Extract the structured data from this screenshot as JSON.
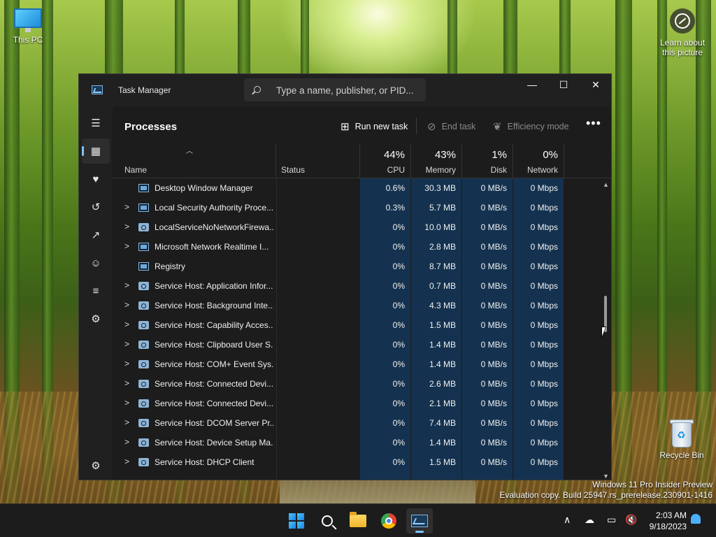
{
  "desktop": {
    "this_pc_label": "This PC",
    "recycle_bin_label": "Recycle Bin",
    "learn_line1": "Learn about",
    "learn_line2": "this picture",
    "watermark_line1": "Windows 11 Pro Insider Preview",
    "watermark_line2": "Evaluation copy. Build 25947.rs_prerelease.230901-1416"
  },
  "window": {
    "title": "Task Manager",
    "search_placeholder": "Type a name, publisher, or PID...",
    "minimize_glyph": "—",
    "maximize_glyph": "☐",
    "close_glyph": "✕"
  },
  "nav": {
    "items": [
      {
        "icon": "hamburger-icon",
        "glyph": "☰"
      },
      {
        "icon": "processes-icon",
        "glyph": "▦"
      },
      {
        "icon": "performance-icon",
        "glyph": "♥"
      },
      {
        "icon": "app-history-icon",
        "glyph": "↺"
      },
      {
        "icon": "startup-apps-icon",
        "glyph": "↗"
      },
      {
        "icon": "users-icon",
        "glyph": "☺"
      },
      {
        "icon": "details-icon",
        "glyph": "≡"
      },
      {
        "icon": "services-icon",
        "glyph": "⚙"
      }
    ],
    "settings_glyph": "⚙"
  },
  "toolbar": {
    "page_title": "Processes",
    "run_new_task": "Run new task",
    "end_task": "End task",
    "efficiency_mode": "Efficiency mode",
    "more_glyph": "•••"
  },
  "columns": {
    "name": "Name",
    "status": "Status",
    "cpu_pct": "44%",
    "cpu": "CPU",
    "memory_pct": "43%",
    "memory": "Memory",
    "disk_pct": "1%",
    "disk": "Disk",
    "network_pct": "0%",
    "network": "Network"
  },
  "processes": [
    {
      "name": "Desktop Window Manager",
      "expandable": false,
      "icon": "box",
      "cpu": "0.6%",
      "memory": "30.3 MB",
      "disk": "0 MB/s",
      "network": "0 Mbps"
    },
    {
      "name": "Local Security Authority Proce...",
      "expandable": true,
      "icon": "box",
      "cpu": "0.3%",
      "memory": "5.7 MB",
      "disk": "0 MB/s",
      "network": "0 Mbps"
    },
    {
      "name": "LocalServiceNoNetworkFirewa...",
      "expandable": true,
      "icon": "gear",
      "cpu": "0%",
      "memory": "10.0 MB",
      "disk": "0 MB/s",
      "network": "0 Mbps"
    },
    {
      "name": "Microsoft Network Realtime I...",
      "expandable": true,
      "icon": "box",
      "cpu": "0%",
      "memory": "2.8 MB",
      "disk": "0 MB/s",
      "network": "0 Mbps"
    },
    {
      "name": "Registry",
      "expandable": false,
      "icon": "box",
      "cpu": "0%",
      "memory": "8.7 MB",
      "disk": "0 MB/s",
      "network": "0 Mbps"
    },
    {
      "name": "Service Host: Application Infor...",
      "expandable": true,
      "icon": "gear",
      "cpu": "0%",
      "memory": "0.7 MB",
      "disk": "0 MB/s",
      "network": "0 Mbps"
    },
    {
      "name": "Service Host: Background Inte...",
      "expandable": true,
      "icon": "gear",
      "cpu": "0%",
      "memory": "4.3 MB",
      "disk": "0 MB/s",
      "network": "0 Mbps"
    },
    {
      "name": "Service Host: Capability Acces...",
      "expandable": true,
      "icon": "gear",
      "cpu": "0%",
      "memory": "1.5 MB",
      "disk": "0 MB/s",
      "network": "0 Mbps"
    },
    {
      "name": "Service Host: Clipboard User S...",
      "expandable": true,
      "icon": "gear",
      "cpu": "0%",
      "memory": "1.4 MB",
      "disk": "0 MB/s",
      "network": "0 Mbps"
    },
    {
      "name": "Service Host: COM+ Event Sys...",
      "expandable": true,
      "icon": "gear",
      "cpu": "0%",
      "memory": "1.4 MB",
      "disk": "0 MB/s",
      "network": "0 Mbps"
    },
    {
      "name": "Service Host: Connected Devi...",
      "expandable": true,
      "icon": "gear",
      "cpu": "0%",
      "memory": "2.6 MB",
      "disk": "0 MB/s",
      "network": "0 Mbps"
    },
    {
      "name": "Service Host: Connected Devi...",
      "expandable": true,
      "icon": "gear",
      "cpu": "0%",
      "memory": "2.1 MB",
      "disk": "0 MB/s",
      "network": "0 Mbps"
    },
    {
      "name": "Service Host: DCOM Server Pr...",
      "expandable": true,
      "icon": "gear",
      "cpu": "0%",
      "memory": "7.4 MB",
      "disk": "0 MB/s",
      "network": "0 Mbps"
    },
    {
      "name": "Service Host: Device Setup Ma...",
      "expandable": true,
      "icon": "gear",
      "cpu": "0%",
      "memory": "1.4 MB",
      "disk": "0 MB/s",
      "network": "0 Mbps"
    },
    {
      "name": "Service Host: DHCP Client",
      "expandable": true,
      "icon": "gear",
      "cpu": "0%",
      "memory": "1.5 MB",
      "disk": "0 MB/s",
      "network": "0 Mbps"
    }
  ],
  "taskbar": {
    "time": "2:03 AM",
    "date": "9/18/2023",
    "tray_chevron": "∧"
  }
}
